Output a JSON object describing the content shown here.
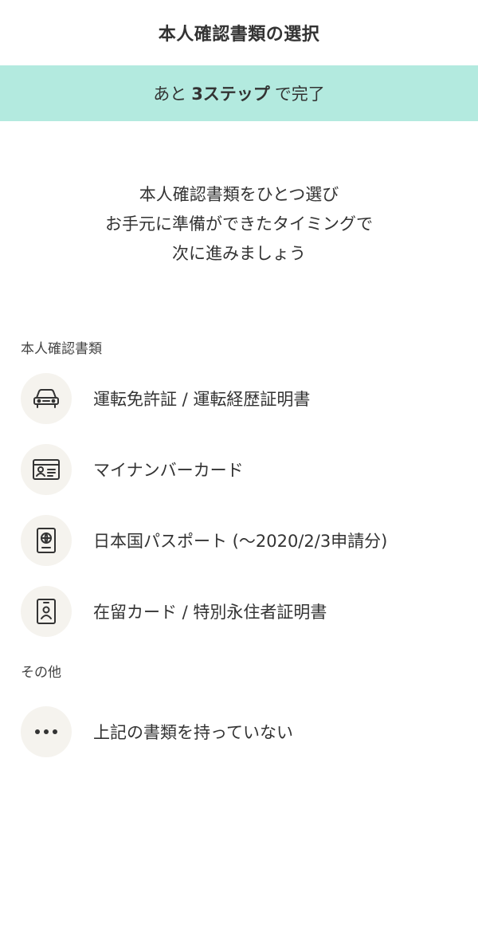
{
  "header": {
    "title": "本人確認書類の選択"
  },
  "progress": {
    "prefix": "あと",
    "steps": "3ステップ",
    "suffix": "で完了"
  },
  "lead": {
    "line1": "本人確認書類をひとつ選び",
    "line2": "お手元に準備ができたタイミングで",
    "line3": "次に進みましょう"
  },
  "sections": {
    "documents": {
      "label": "本人確認書類",
      "items": [
        {
          "label": "運転免許証 / 運転経歴証明書",
          "icon": "car-icon"
        },
        {
          "label": "マイナンバーカード",
          "icon": "id-card-icon"
        },
        {
          "label": "日本国パスポート (～2020/2/3申請分)",
          "icon": "passport-icon"
        },
        {
          "label": "在留カード / 特別永住者証明書",
          "icon": "residence-card-icon"
        }
      ]
    },
    "other": {
      "label": "その他",
      "items": [
        {
          "label": "上記の書類を持っていない",
          "icon": "more-icon"
        }
      ]
    }
  },
  "colors": {
    "banner": "#b3eadf",
    "icon_bg": "#f5f3ee",
    "text": "#333333"
  }
}
